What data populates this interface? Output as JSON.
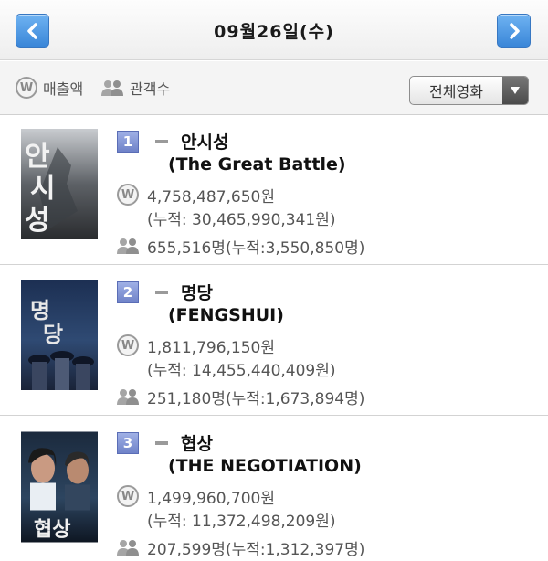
{
  "header": {
    "date": "09월26일(수)",
    "prev_icon": "chevron-left-icon",
    "next_icon": "chevron-right-icon"
  },
  "filter": {
    "sales_label": "매출액",
    "audience_label": "관객수",
    "select_value": "전체영화"
  },
  "movies": [
    {
      "rank": "1",
      "title_ko": "안시성",
      "title_en": "(The Great Battle)",
      "sales": "4,758,487,650원",
      "cumulative_sales": "(누적: 30,465,990,341원)",
      "audience": "655,516명(누적:3,550,850명)",
      "poster_text": "안시성"
    },
    {
      "rank": "2",
      "title_ko": "명당",
      "title_en": "(FENGSHUI)",
      "sales": "1,811,796,150원",
      "cumulative_sales": "(누적: 14,455,440,409원)",
      "audience": "251,180명(누적:1,673,894명)",
      "poster_text": "명당"
    },
    {
      "rank": "3",
      "title_ko": "협상",
      "title_en": "(THE NEGOTIATION)",
      "sales": "1,499,960,700원",
      "cumulative_sales": "(누적: 11,372,498,209원)",
      "audience": "207,599명(누적:1,312,397명)",
      "poster_text": "협상"
    }
  ],
  "colors": {
    "nav_button": "#4a93e0",
    "rank_badge": "#7f92d4",
    "text_gray": "#555555"
  }
}
